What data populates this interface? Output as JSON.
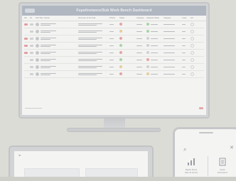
{
  "dashboard": {
    "title": "Fupa/Instance/Sub Work Bench Dashboard",
    "columns": [
      "Sel",
      "ID",
      "Sub Title / Owner",
      "Summary of the Task",
      "Priority",
      "Status",
      "Assignee",
      "Assigned Tasks",
      "Category",
      "Level",
      "Act"
    ],
    "rows": [
      {
        "flag": true,
        "status_color": "#e3a4a4",
        "accent": "#a7d4a7"
      },
      {
        "flag": false,
        "status_color": "#e6cd9a",
        "accent": "#a7d4a7"
      },
      {
        "flag": true,
        "status_color": "#e3a4a4",
        "accent": "#cfd0d2"
      },
      {
        "flag": true,
        "status_color": "#a7d4a7",
        "accent": "#cfd0d2"
      },
      {
        "flag": true,
        "status_color": "#e3a4a4",
        "accent": "#cfd0d2"
      },
      {
        "flag": false,
        "status_color": "#a7d4a7",
        "accent": "#e3a4a4"
      },
      {
        "flag": false,
        "status_color": "#e6cd9a",
        "accent": "#cfd0d2"
      },
      {
        "flag": false,
        "status_color": "#e3a4a4",
        "accent": "#e6cd9a"
      }
    ]
  },
  "phone": {
    "cards": [
      {
        "title": "Repair Flows",
        "subtitle": "(last 24 hours)",
        "icon": "chart-icon"
      },
      {
        "title": "Quick",
        "subtitle": "Instructions",
        "icon": "list-icon"
      }
    ]
  },
  "colors": {
    "accent_red": "#e29f9f",
    "header": "#b0b7c1"
  }
}
